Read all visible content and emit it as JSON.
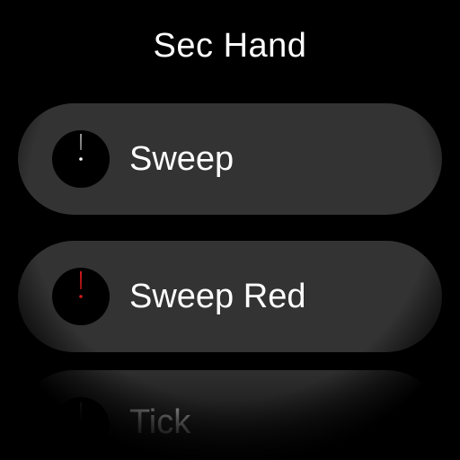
{
  "screen_title": "Sec Hand",
  "options": [
    {
      "label": "Sweep",
      "preview_icon": "white-second-hand-icon",
      "hand_color": "#ffffff"
    },
    {
      "label": "Sweep Red",
      "preview_icon": "red-second-hand-icon",
      "hand_color": "#d11a1a"
    },
    {
      "label": "Tick",
      "preview_icon": "tick-second-hand-icon",
      "hand_color": "#ffffff"
    }
  ],
  "colors": {
    "background": "#000000",
    "chip_background": "#333333",
    "text": "#ffffff"
  }
}
